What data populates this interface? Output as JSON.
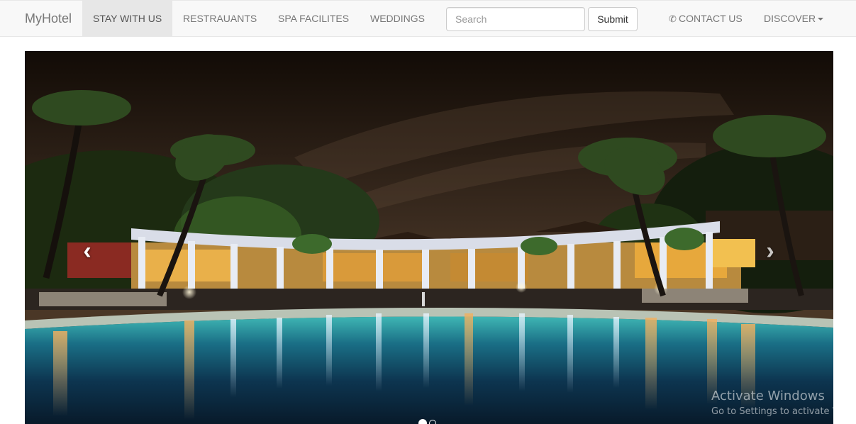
{
  "navbar": {
    "brand": "MyHotel",
    "items": [
      {
        "label": "STAY WITH US",
        "active": true
      },
      {
        "label": "RESTRAUANTS"
      },
      {
        "label": "SPA FACILITES"
      },
      {
        "label": "WEDDINGS"
      }
    ],
    "search": {
      "placeholder": "Search",
      "value": ""
    },
    "submit_label": "Submit",
    "contact": {
      "icon": "phone-icon",
      "label": "CONTACT US"
    },
    "discover": {
      "label": "DISCOVER",
      "icon": "caret-down-icon"
    }
  },
  "carousel": {
    "image": "night-resort-pool-with-palm-trees",
    "prev_icon": "chevron-left-icon",
    "next_icon": "chevron-right-icon",
    "prev_glyph": "‹",
    "next_glyph": "›",
    "slide_count": 2,
    "active_slide": 1
  },
  "os_watermark": {
    "line1": "Activate Windows",
    "line2": "Go to Settings to activate Windows."
  },
  "colors": {
    "navbar_bg": "#f8f8f8",
    "active_tab_bg": "#e7e7e7",
    "nav_text": "#777777"
  }
}
